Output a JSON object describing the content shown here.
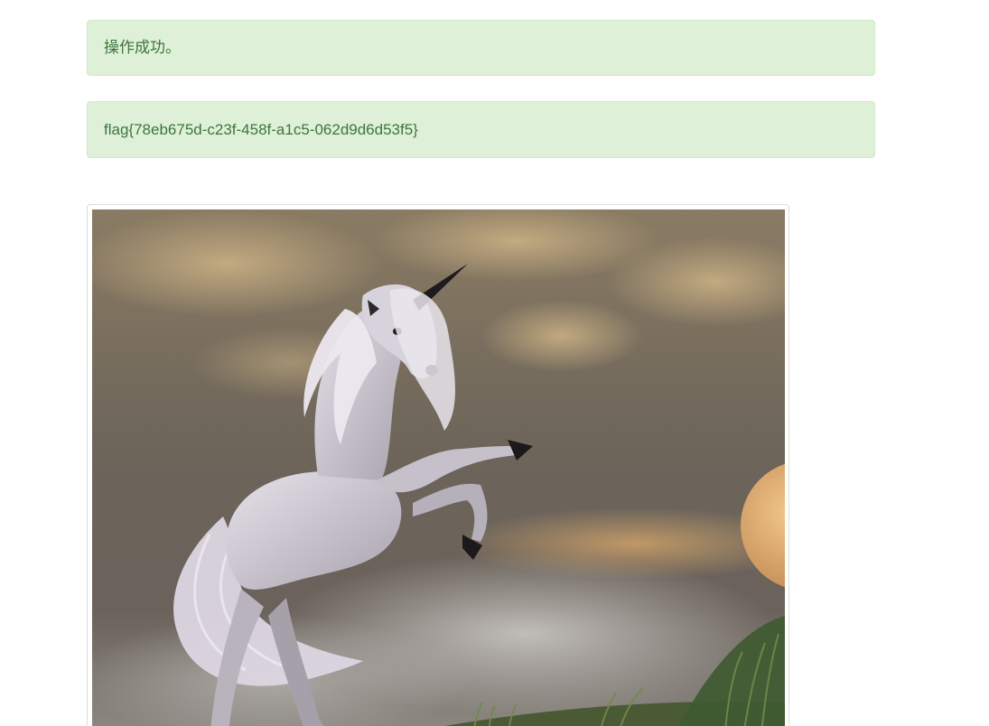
{
  "alerts": {
    "success_message": "操作成功。",
    "flag_message": "flag{78eb675d-c23f-458f-a1c5-062d9d6d53f5}"
  },
  "image": {
    "subject": "unicorn-rearing-in-stormy-sky",
    "colors": {
      "sky_dark": "#6f6558",
      "sky_light": "#b9a27a",
      "unicorn": "#d8d4dc",
      "horn": "#1e1b1f",
      "moon": "#e8b574",
      "grass": "#4f6a3a"
    }
  }
}
